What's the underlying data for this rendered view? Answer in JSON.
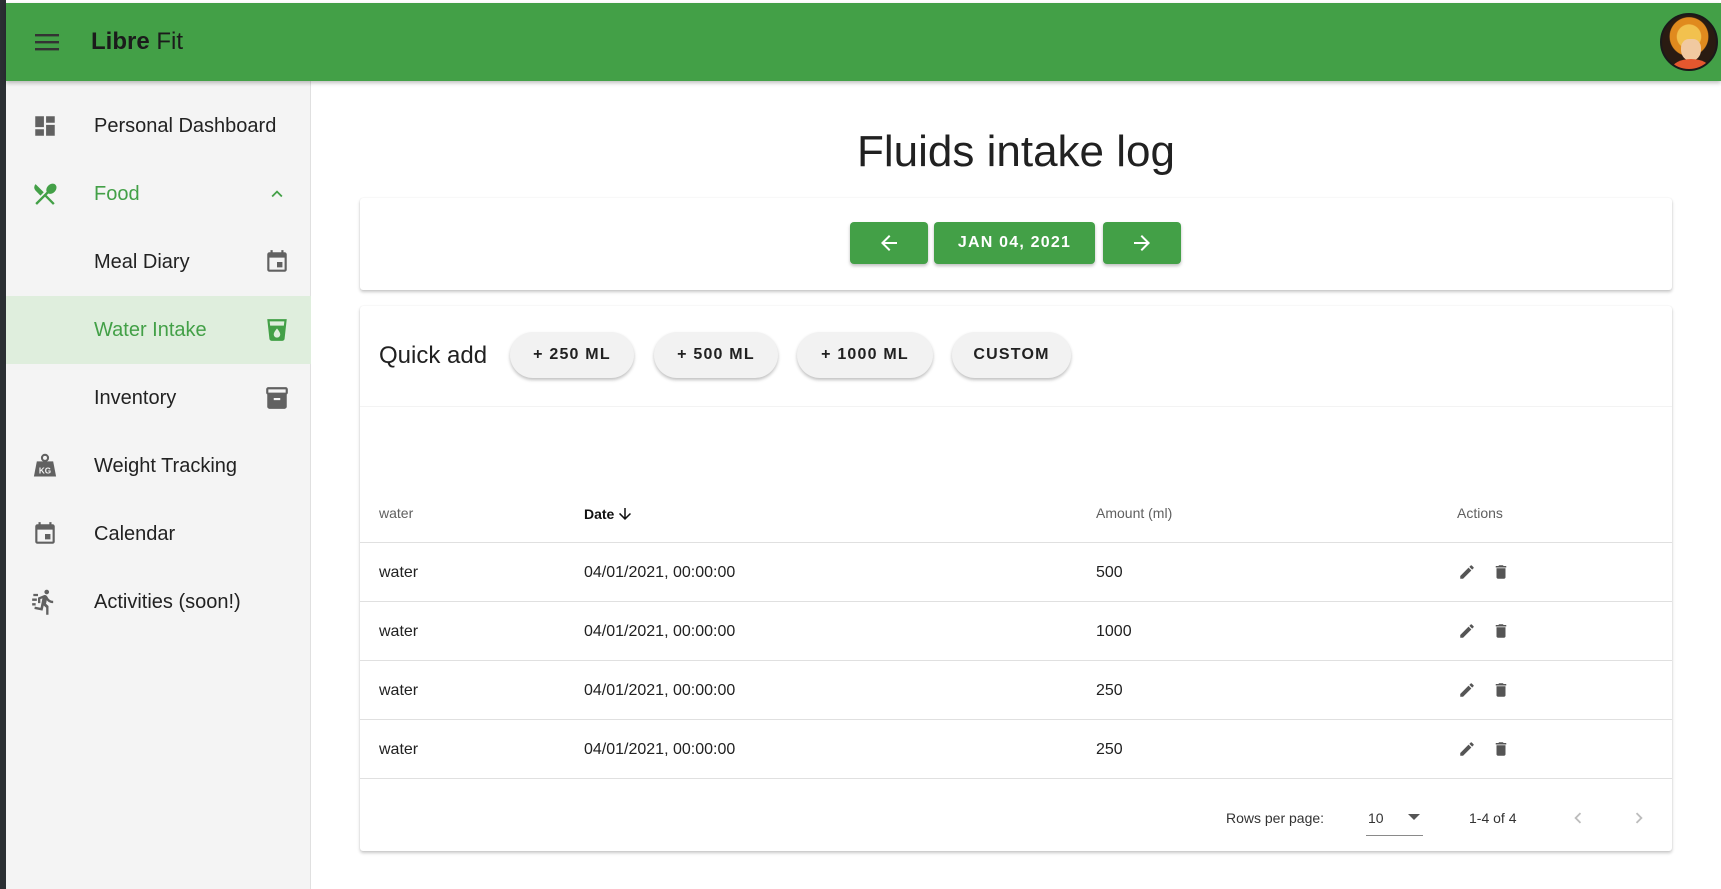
{
  "app": {
    "title_bold": "Libre",
    "title_light": "Fit"
  },
  "sidebar": {
    "items": [
      {
        "label": "Personal Dashboard",
        "icon": "dashboard-icon"
      },
      {
        "label": "Food",
        "icon": "food-icon",
        "expanded": true
      },
      {
        "label": "Meal Diary",
        "icon": "calendar-event-icon"
      },
      {
        "label": "Water Intake",
        "icon": "water-cup-icon",
        "active": true
      },
      {
        "label": "Inventory",
        "icon": "archive-icon"
      },
      {
        "label": "Weight Tracking",
        "icon": "weight-kg-icon"
      },
      {
        "label": "Calendar",
        "icon": "calendar-icon"
      },
      {
        "label": "Activities (soon!)",
        "icon": "running-icon"
      }
    ]
  },
  "main": {
    "title": "Fluids intake log",
    "date_nav": {
      "date_label": "JAN 04, 2021"
    },
    "quick_add": {
      "label": "Quick add",
      "buttons": [
        "+ 250 ML",
        "+ 500 ML",
        "+ 1000 ML",
        "CUSTOM"
      ]
    },
    "table": {
      "headers": {
        "name": "water",
        "date": "Date",
        "amount": "Amount (ml)",
        "actions": "Actions"
      },
      "rows": [
        {
          "name": "water",
          "date": "04/01/2021, 00:00:00",
          "amount": "500"
        },
        {
          "name": "water",
          "date": "04/01/2021, 00:00:00",
          "amount": "1000"
        },
        {
          "name": "water",
          "date": "04/01/2021, 00:00:00",
          "amount": "250"
        },
        {
          "name": "water",
          "date": "04/01/2021, 00:00:00",
          "amount": "250"
        }
      ],
      "pagination": {
        "rows_per_page_label": "Rows per page:",
        "rows_per_page": "10",
        "range": "1-4 of 4"
      }
    }
  },
  "colors": {
    "primary": "#43a047",
    "active_bg": "#dfeedd",
    "sidebar_bg": "#f4f4f4"
  }
}
